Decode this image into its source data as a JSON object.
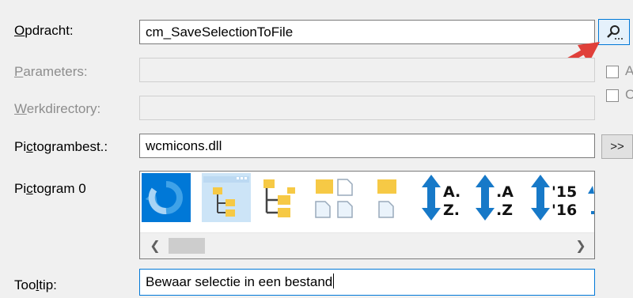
{
  "labels": {
    "command": "Opdracht:",
    "parameters": "Parameters:",
    "workdir": "Werkdirectory:",
    "iconfile": "Pictogrambest.:",
    "icon_prefix": "Pictogram ",
    "icon_index": "0",
    "tooltip": "Tooltip:"
  },
  "fields": {
    "command_value": "cm_SaveSelectionToFile",
    "parameters_value": "",
    "workdir_value": "",
    "iconfile_value": "wcmicons.dll",
    "tooltip_value": "Bewaar selectie in een bestand"
  },
  "buttons": {
    "browse_iconfile": ">>"
  },
  "checkboxes": [
    {
      "label": "A",
      "checked": false
    },
    {
      "label": "C",
      "checked": false
    }
  ],
  "icons": [
    "refresh-icon",
    "tree-view-icon",
    "folder-tree-icon",
    "folders-files-icon",
    "folder-file-icon",
    "sort-az-icon",
    "sort-za-icon",
    "sort-date-icon"
  ],
  "sort_icon_text": {
    "az_top": "A.",
    "az_bottom": "Z.",
    "za_top": ".A",
    "za_bottom": ".Z",
    "date_top": "'15",
    "date_bottom": "'16"
  },
  "scroll": {
    "left": "❮",
    "right": "❯"
  },
  "colors": {
    "selection": "#0078d7",
    "accent_border": "#0078d7",
    "arrow": "#e0403a",
    "folder": "#f6c945",
    "sort_blue": "#1779c8"
  }
}
